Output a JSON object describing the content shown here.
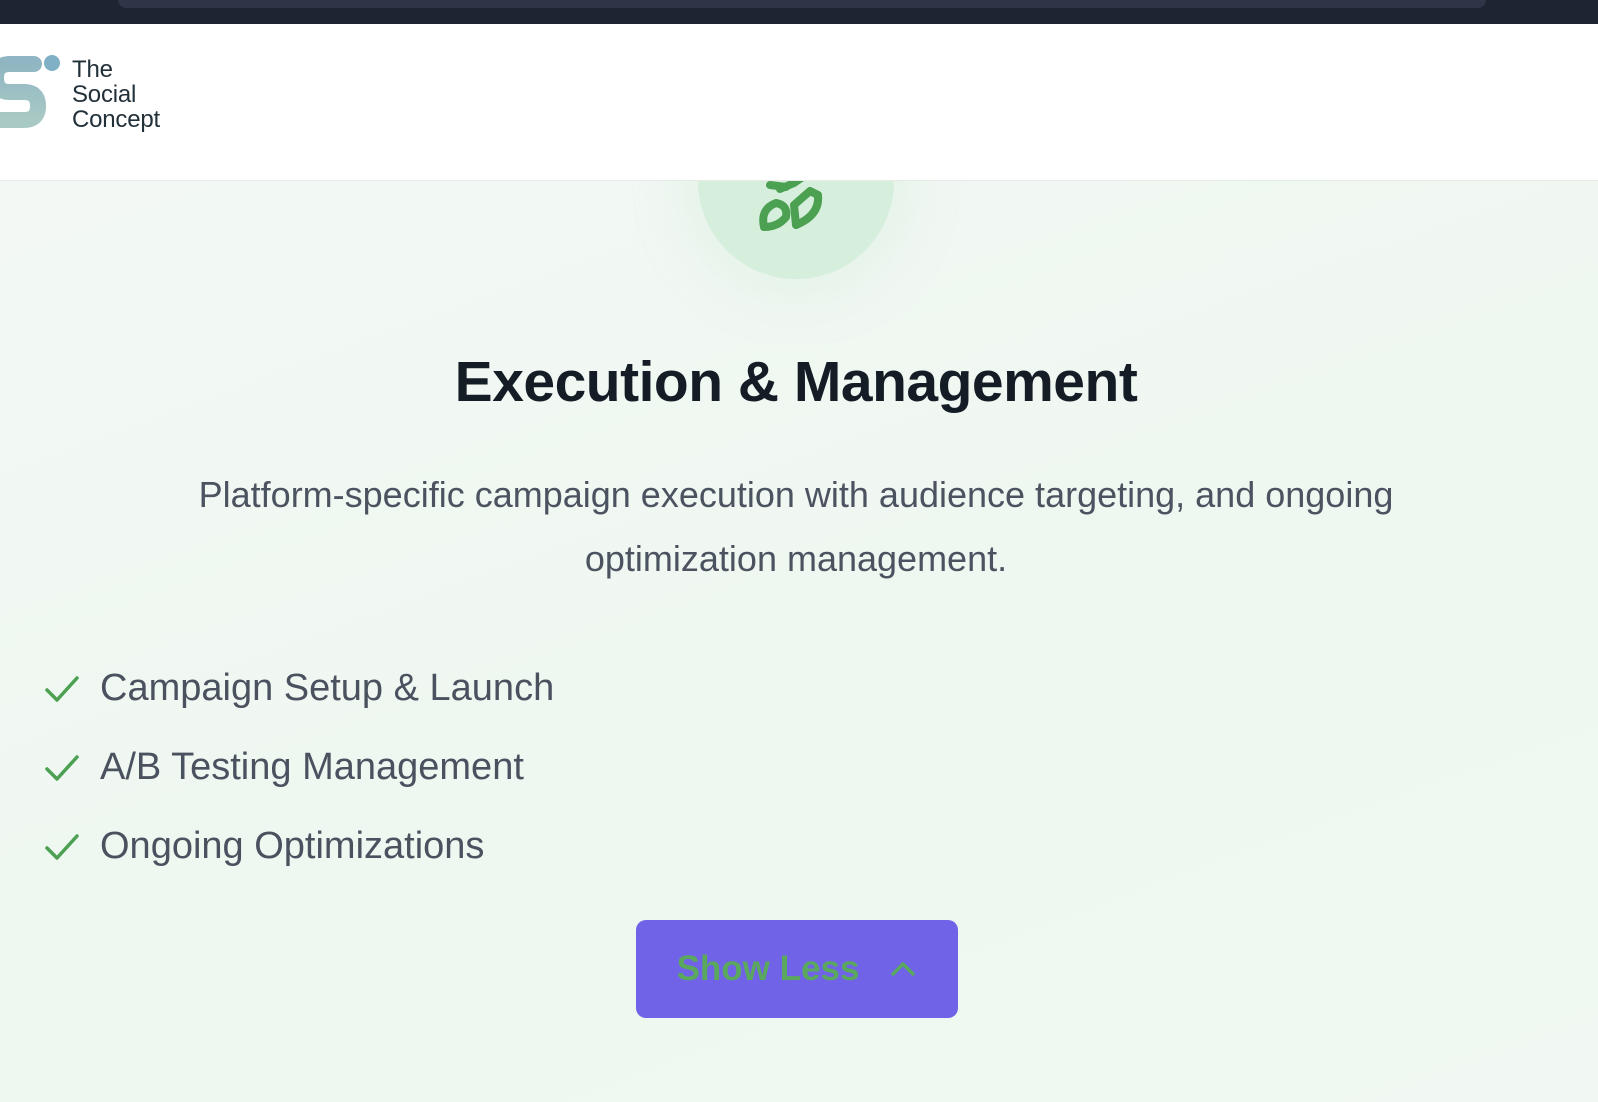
{
  "header": {
    "logo": {
      "lines": [
        "The",
        "Social",
        "Concept"
      ]
    }
  },
  "service": {
    "icon": "rocket-icon",
    "title": "Execution & Management",
    "description": "Platform-specific campaign execution with audience targeting, and ongoing optimization management.",
    "features": [
      {
        "label": "Campaign Setup & Launch",
        "icon": "check-icon"
      },
      {
        "label": "A/B Testing Management",
        "icon": "check-icon"
      },
      {
        "label": "Ongoing Optimizations",
        "icon": "check-icon"
      }
    ],
    "toggle_button": {
      "label": "Show Less",
      "icon": "chevron-up-icon"
    }
  },
  "colors": {
    "accent_green": "#4ca052",
    "button_purple": "#7163e8",
    "icon_circle": "#d5efdc",
    "title_text": "#141c26",
    "body_text": "#4b5360"
  }
}
